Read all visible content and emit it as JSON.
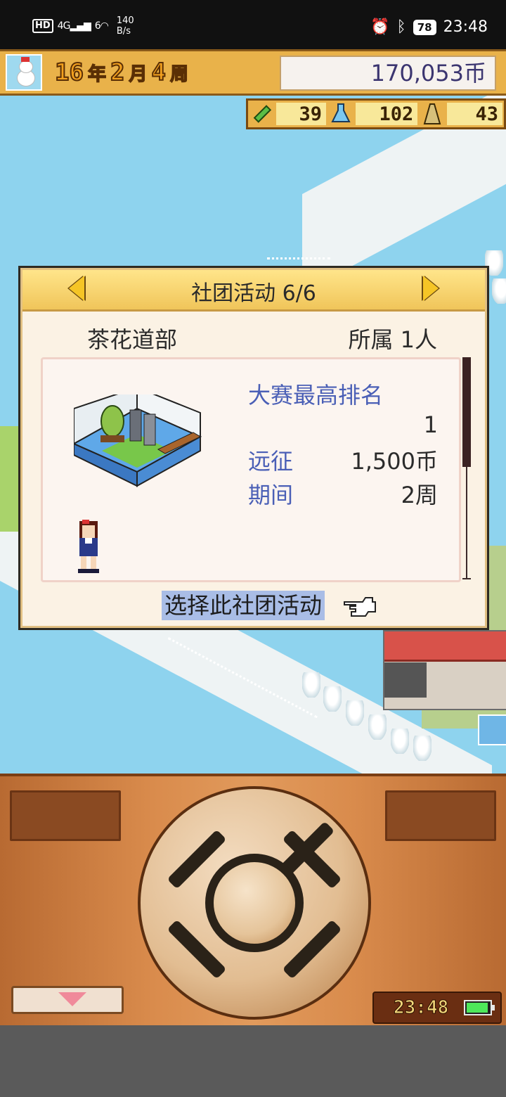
{
  "status_bar": {
    "hd": "HD",
    "signal1": "4G",
    "signal2": "6",
    "speed_value": "140",
    "speed_unit": "B/s",
    "battery": "78",
    "time": "23:48"
  },
  "hud": {
    "year": "16",
    "year_unit": "年",
    "month": "2",
    "month_unit": "月",
    "week": "4",
    "week_unit": "周",
    "money": "170,053币"
  },
  "stats": [
    {
      "icon": "pencil-icon",
      "value": "39"
    },
    {
      "icon": "flask-icon",
      "value": "102"
    },
    {
      "icon": "pylon-icon",
      "value": "43"
    }
  ],
  "dialog": {
    "title": "社团活动 6/6",
    "club_name": "茶花道部",
    "members": "所属 1人",
    "info_title": "大赛最高排名",
    "rank_value": "1",
    "rows": [
      {
        "label": "远征",
        "value": "1,500币"
      },
      {
        "label": "期间",
        "value": "2周"
      }
    ],
    "select_label": "选择此社团活动"
  },
  "controller": {
    "clock": "23:48"
  }
}
